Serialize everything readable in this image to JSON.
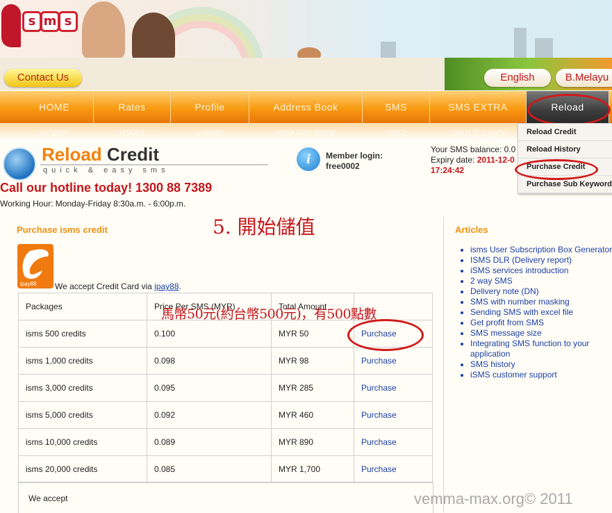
{
  "header": {
    "logo_text": "isms",
    "contact_label": "Contact Us",
    "languages": [
      "English",
      "B.Melayu"
    ]
  },
  "nav": {
    "items": [
      "HOME",
      "Rates",
      "Profile",
      "Address Book",
      "SMS",
      "SMS EXTRA",
      "Reload"
    ],
    "active": "Reload"
  },
  "dropdown": {
    "items": [
      "Reload Credit",
      "Reload History",
      "Purchase Credit",
      "Purchase Sub Keyword"
    ]
  },
  "reload_banner": {
    "title_a": "Reload",
    "title_b": "Credit",
    "tagline": "quick & easy sms"
  },
  "member": {
    "label": "Member login:",
    "username": "free0002"
  },
  "balance": {
    "label": "Your SMS balance: 0.0",
    "expiry_label": "Expiry date:",
    "expiry_date": "2011-12-0",
    "expiry_time": "17:24:42"
  },
  "hotline": "Call our hotline today! 1300 88 7389",
  "working_hours": "Working Hour: Monday-Friday 8:30a.m. - 6:00p.m.",
  "purchase": {
    "heading": "Purchase isms credit",
    "ipay_logo_text": "ipay88",
    "accept_text": "We accept Credit Card via ",
    "accept_link": "ipay88",
    "accept_end": ".",
    "columns": [
      "Packages",
      "Price Per SMS (MYR)",
      "Total Amount",
      ""
    ],
    "rows": [
      {
        "package": "isms 500 credits",
        "price": "0.100",
        "total": "MYR 50",
        "action": "Purchase"
      },
      {
        "package": "isms 1,000 credits",
        "price": "0.098",
        "total": "MYR 98",
        "action": "Purchase"
      },
      {
        "package": "isms 3,000 credits",
        "price": "0.095",
        "total": "MYR 285",
        "action": "Purchase"
      },
      {
        "package": "isms 5,000 credits",
        "price": "0.092",
        "total": "MYR 460",
        "action": "Purchase"
      },
      {
        "package": "isms 10,000 credits",
        "price": "0.089",
        "total": "MYR 890",
        "action": "Purchase"
      },
      {
        "package": "isms 20,000 credits",
        "price": "0.085",
        "total": "MYR 1,700",
        "action": "Purchase"
      }
    ],
    "footer_text": "We accept"
  },
  "annotations": {
    "step": "5. 開始儲值",
    "note": "馬幣50元(約台幣500元)，有500點數"
  },
  "articles": {
    "heading": "Articles",
    "items": [
      "isms User Subscription Box Generator",
      "ISMS DLR (Delivery report)",
      "iSMS services introduction",
      "2 way SMS",
      "Delivery note (DN)",
      "SMS with number masking",
      "Sending SMS with excel file",
      "Get profit from SMS",
      "SMS message size",
      "Integrating SMS function to your application",
      "SMS history",
      "iSMS customer support"
    ]
  },
  "watermark": "vemma-max.org© 2011",
  "colors": {
    "accent_orange": "#f0900f",
    "nav_orange": "#f89a10",
    "red": "#c4161c",
    "link_blue": "#1b3fa6"
  }
}
